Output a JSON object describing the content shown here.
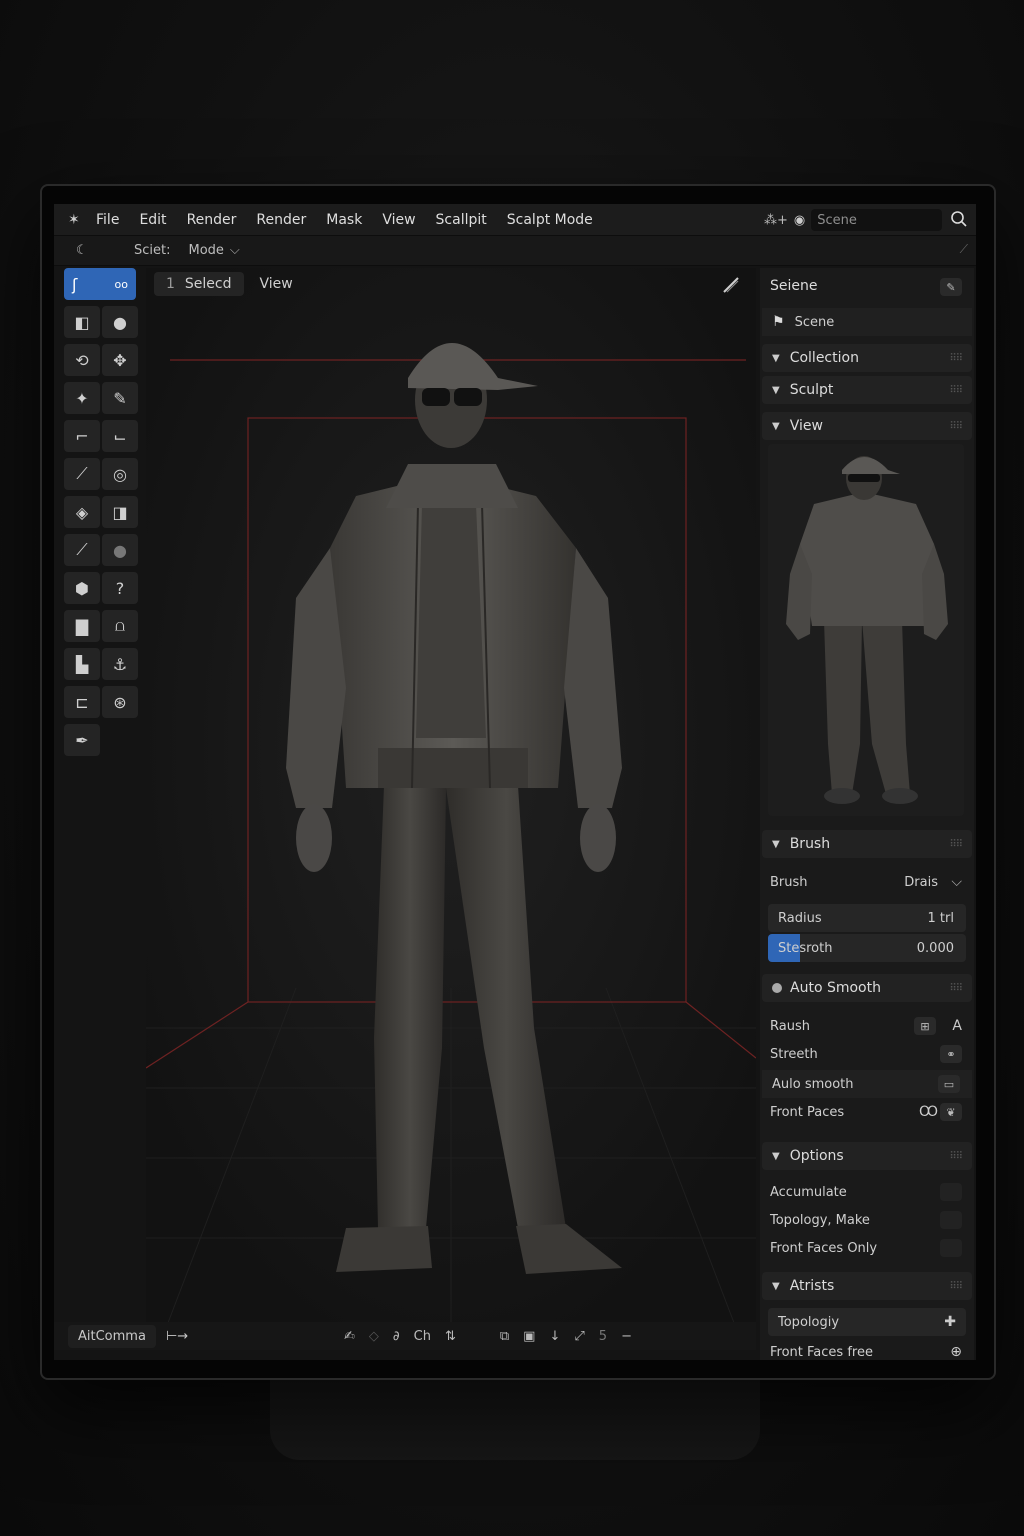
{
  "menubar": {
    "items": [
      "File",
      "Edit",
      "Render",
      "Render",
      "Mask",
      "View",
      "Scallpit",
      "Scalpt Mode"
    ],
    "scene_field": "Scene"
  },
  "subbar": {
    "scene_label": "Sciet:",
    "mode_label": "Mode"
  },
  "viewport": {
    "select_number": "1",
    "select_label": "Selecd",
    "view_label": "View"
  },
  "bottombar": {
    "command": "AitComma",
    "mid_label": "Ch",
    "right_number": "5"
  },
  "panel": {
    "scene_header": "Seiene",
    "scene_item": "Scene",
    "collection": "Collection",
    "sculpt": "Sculpt",
    "view": "View",
    "brush_header": "Brush",
    "brush_label": "Brush",
    "brush_value": "Drais",
    "radius_label": "Radius",
    "radius_value": "1 trl",
    "strength_label": "Stesroth",
    "strength_value": "0.000",
    "auto_smooth_header": "Auto Smooth",
    "raush": "Raush",
    "streeth": "Streeth",
    "aulo_smooth": "Aulo smooth",
    "front_paces": "Front Paces",
    "options_header": "Options",
    "accumulate": "Accumulate",
    "topology_make": "Topology, Make",
    "front_faces_only": "Front Faces Only",
    "atrists_header": "Atrists",
    "topologiy": "Topologiy",
    "front_faces_free": "Front Faces free"
  },
  "colors": {
    "accent": "#2f66b6",
    "grid_red": "#7a2323",
    "panel_bg": "#1a1a1a"
  }
}
